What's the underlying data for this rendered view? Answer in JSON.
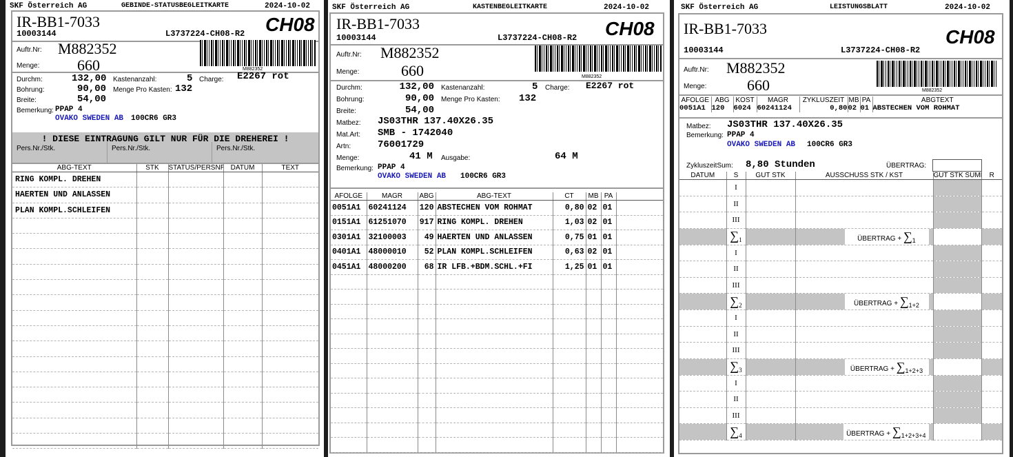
{
  "common": {
    "company": "SKF Österreich AG",
    "date": "2024-10-02",
    "part_id": "IR-BB1-7033",
    "number": "10003144",
    "lot": "L3737224-CH08-R2",
    "ch": "CH08",
    "auftr_label": "Auftr.Nr:",
    "auftr_value": "M882352",
    "menge_label": "Menge:",
    "menge_value": "660",
    "barcode_number": "M882352"
  },
  "sheet1": {
    "title": "GEBINDE-STATUSBEGLEITKARTE",
    "durchm_label": "Durchm:",
    "durchm_value": "132,00",
    "bohrung_label": "Bohrung:",
    "bohrung_value": "90,00",
    "breite_label": "Breite:",
    "breite_value": "54,00",
    "kastenanzahl_label": "Kastenanzahl:",
    "kastenanzahl_value": "5",
    "menge_pro_kasten_label": "Menge Pro Kasten:",
    "menge_pro_kasten_value": "132",
    "charge_label": "Charge:",
    "charge_value": "E2267 rot",
    "bemerkung_label": "Bemerkung:",
    "bemerkung_value": "PPAP 4",
    "ovako": "OVAKO SWEDEN AB",
    "material": "100CR6 GR3",
    "notice": "! DIESE EINTRAGUNG GILT NUR FÜR DIE DREHEREI !",
    "pers1": "Pers.Nr./Stk.",
    "pers2": "Pers.Nr./Stk.",
    "pers3": "Pers.Nr./Stk.",
    "table_headers": [
      "ABG-TEXT",
      "STK",
      "STATUS/PERSNR.",
      "DATUM",
      "TEXT"
    ],
    "rows": [
      "RING KOMPL. DREHEN",
      "HAERTEN UND ANLASSEN",
      "PLAN KOMPL.SCHLEIFEN"
    ]
  },
  "sheet2": {
    "title": "KASTENBEGLEITKARTE",
    "durchm_label": "Durchm:",
    "durchm_value": "132,00",
    "bohrung_label": "Bohrung:",
    "bohrung_value": "90,00",
    "breite_label": "Breite:",
    "breite_value": "54,00",
    "kastenanzahl_label": "Kastenanzahl:",
    "kastenanzahl_value": "5",
    "menge_pro_kasten_label": "Menge Pro Kasten:",
    "menge_pro_kasten_value": "132",
    "charge_label": "Charge:",
    "charge_value": "E2267 rot",
    "matbez_label": "Matbez:",
    "matbez_value": "JS03THR 137.40X26.35",
    "matart_label": "Mat.Art:",
    "matart_value": "SMB - 1742040",
    "artn_label": "Artn:",
    "artn_value": "76001729",
    "menge2_label": "Menge:",
    "menge2_value": "41 M",
    "ausgabe_label": "Ausgabe:",
    "ausgabe_value": "64 M",
    "bemerkung_label": "Bemerkung:",
    "bemerkung_value": "PPAP 4",
    "ovako": "OVAKO SWEDEN AB",
    "material": "100CR6 GR3",
    "table_headers": [
      "AFOLGE",
      "MAGR",
      "ABG",
      "ABG-TEXT",
      "CT",
      "MB",
      "PA"
    ],
    "rows": [
      [
        "0051A1",
        "60241124",
        "120",
        "ABSTECHEN VOM ROHMAT",
        "0,80",
        "02",
        "01"
      ],
      [
        "0151A1",
        "61251070",
        "917",
        "RING KOMPL. DREHEN",
        "1,03",
        "02",
        "01"
      ],
      [
        "0301A1",
        "32100003",
        "49",
        "HAERTEN UND ANLASSEN",
        "0,75",
        "01",
        "01"
      ],
      [
        "0401A1",
        "48000010",
        "52",
        "PLAN KOMPL.SCHLEIFEN",
        "0,63",
        "02",
        "01"
      ],
      [
        "0451A1",
        "48000200",
        "68",
        "IR LFB.+BDM.SCHL.+FI",
        "1,25",
        "01",
        "01"
      ]
    ]
  },
  "sheet3": {
    "title": "LEISTUNGSBLATT",
    "info_headers": [
      "AFOLGE",
      "ABG",
      "KOST",
      "MAGR",
      "ZYKLUSZEIT",
      "MB",
      "PA",
      "ABGTEXT"
    ],
    "info_values": [
      "0051A1",
      "120",
      "6024",
      "60241124",
      "0,80",
      "02",
      "01",
      "ABSTECHEN VOM ROHMAT"
    ],
    "matbez_label": "Matbez:",
    "matbez_value": "JS03THR 137.40X26.35",
    "bemerkung_label": "Bemerkung:",
    "bemerkung_value": "PPAP 4",
    "ovako": "OVAKO SWEDEN AB",
    "material": "100CR6 GR3",
    "zyklus_label": "ZykluszeitSum:",
    "zyklus_value": "8,80 Stunden",
    "uebertrag_label": "ÜBERTRAG:",
    "table_headers": [
      "DATUM",
      "S",
      "GUT STK",
      "AUSSCHUSS STK / KST",
      "GUT STK SUMMEN",
      "R"
    ],
    "shifts": [
      "I",
      "II",
      "III"
    ],
    "sum_symbol": "∑",
    "uebertrag_text": "ÜBERTRAG + ",
    "sums": [
      {
        "sub": "1",
        "label_sub": "1"
      },
      {
        "sub": "2",
        "label_sub": "1+2"
      },
      {
        "sub": "3",
        "label_sub": "1+2+3"
      },
      {
        "sub": "4",
        "label_sub": "1+2+3+4"
      }
    ]
  }
}
